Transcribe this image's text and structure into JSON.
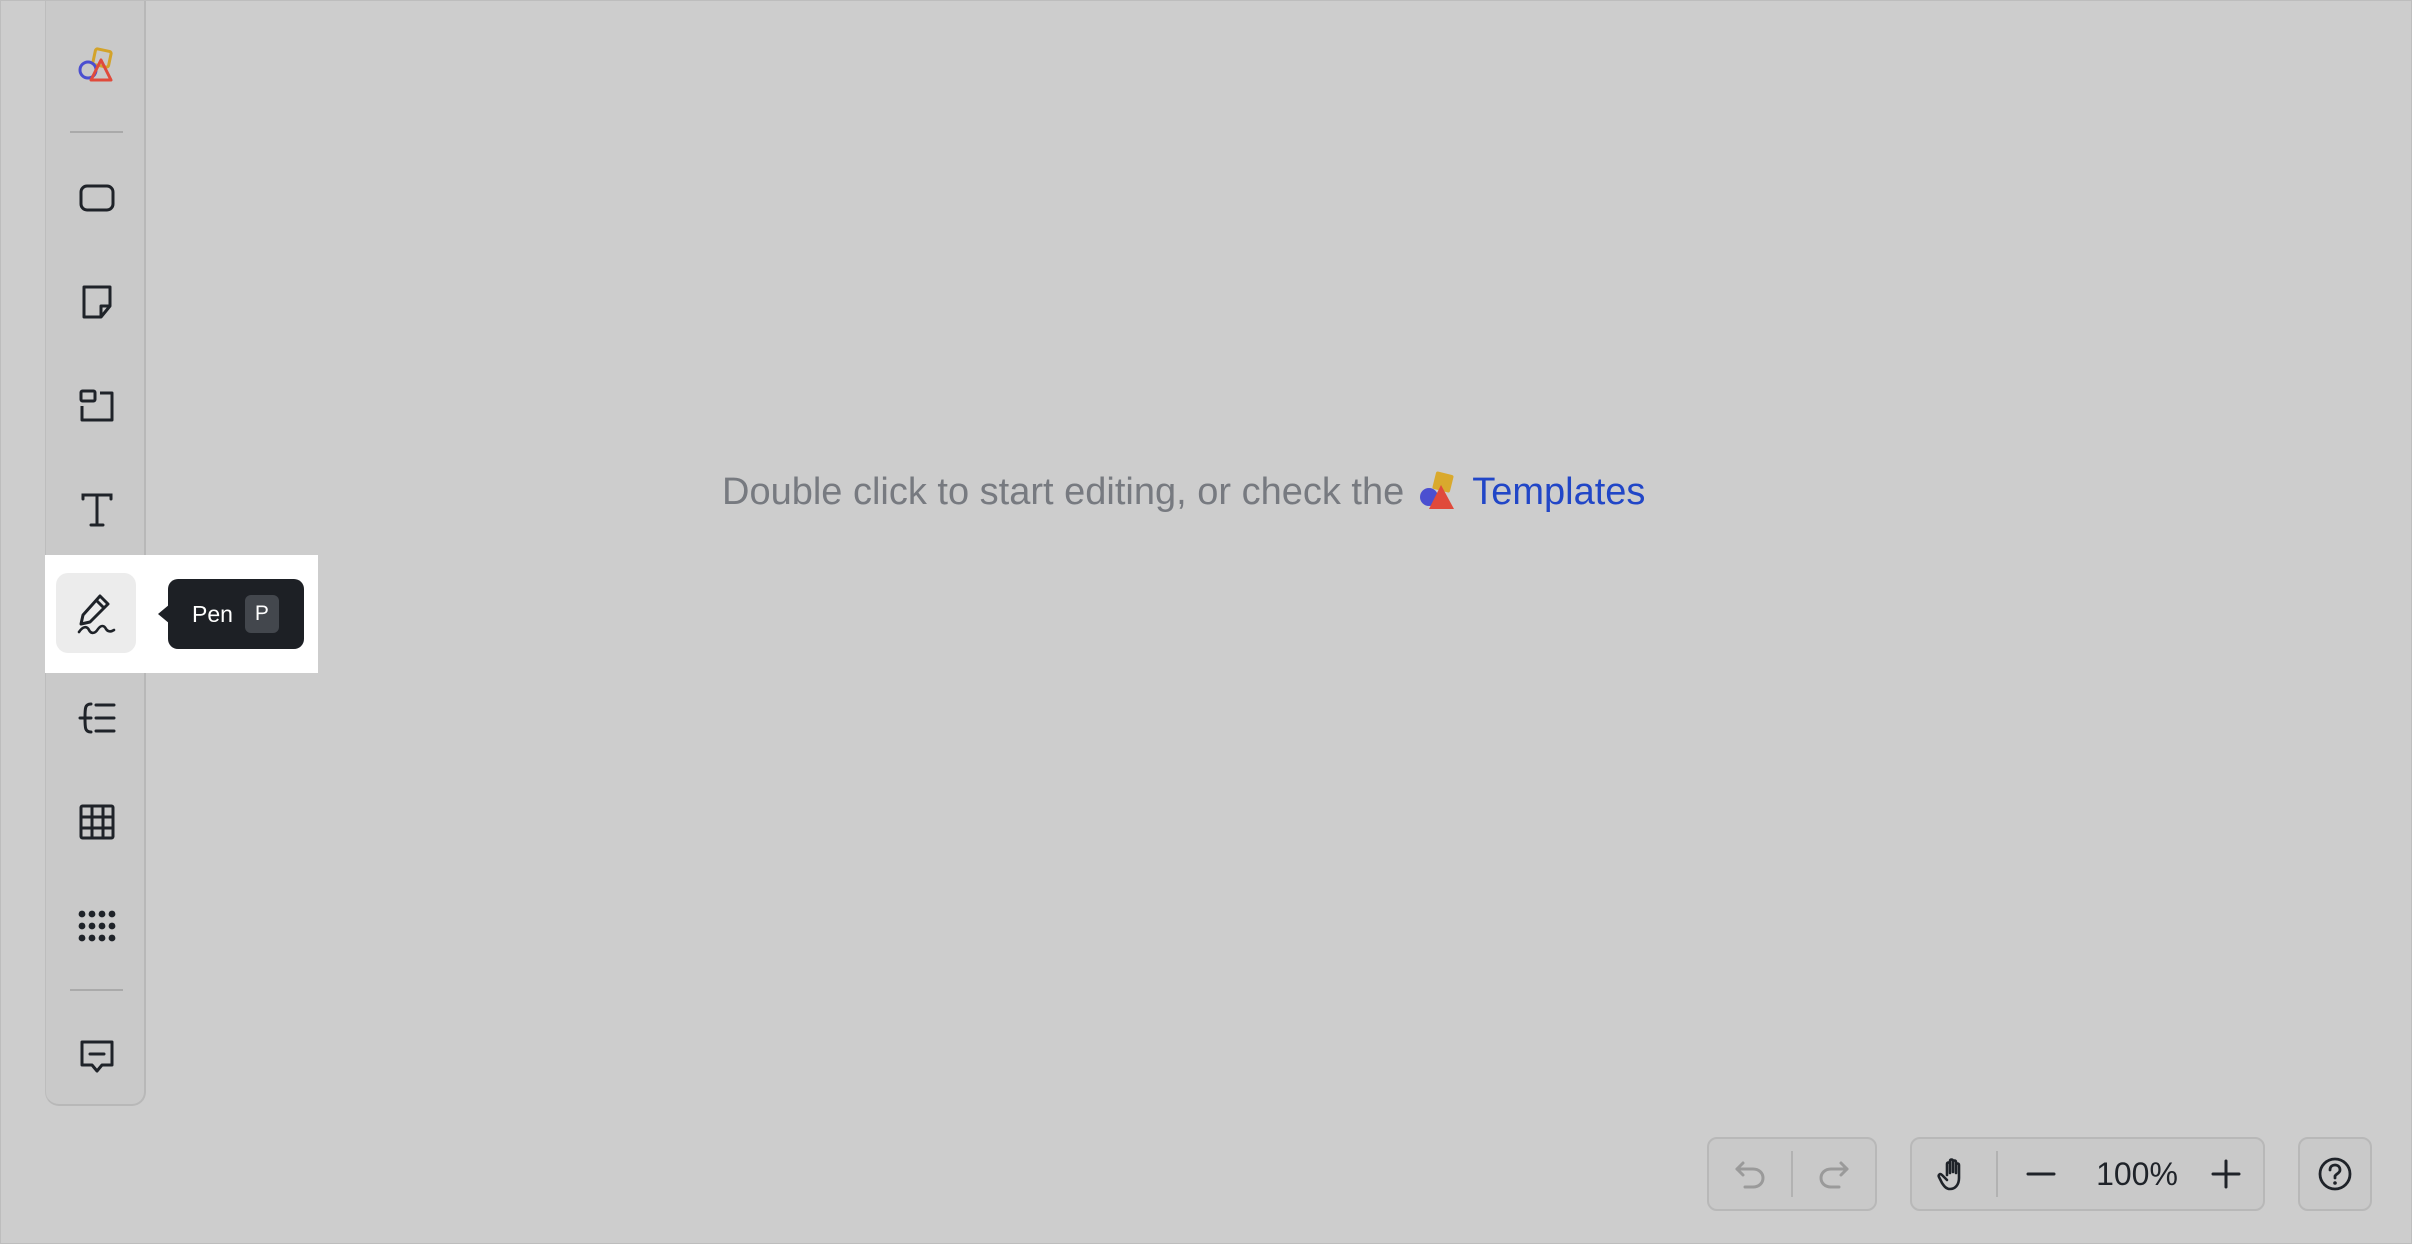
{
  "toolbar": {
    "tools": [
      {
        "name": "templates",
        "icon": "shapes-logo-icon"
      },
      {
        "name": "shape",
        "icon": "rounded-rect-icon"
      },
      {
        "name": "sticky-note",
        "icon": "sticky-note-icon"
      },
      {
        "name": "frame",
        "icon": "frame-icon"
      },
      {
        "name": "text",
        "icon": "text-icon"
      },
      {
        "name": "pen",
        "icon": "pen-icon",
        "active": true
      },
      {
        "name": "mind-map",
        "icon": "mind-map-icon"
      },
      {
        "name": "table",
        "icon": "table-icon"
      },
      {
        "name": "more",
        "icon": "apps-grid-icon"
      },
      {
        "name": "comment",
        "icon": "comment-icon"
      }
    ]
  },
  "tooltip": {
    "label": "Pen",
    "shortcut": "P"
  },
  "hint": {
    "text": "Double click to start editing, or check the",
    "link": "Templates"
  },
  "controls": {
    "zoom": "100%"
  },
  "colors": {
    "link": "#2146c7",
    "tooltip_bg": "#1d2025",
    "canvas": "#cdcdcd"
  }
}
